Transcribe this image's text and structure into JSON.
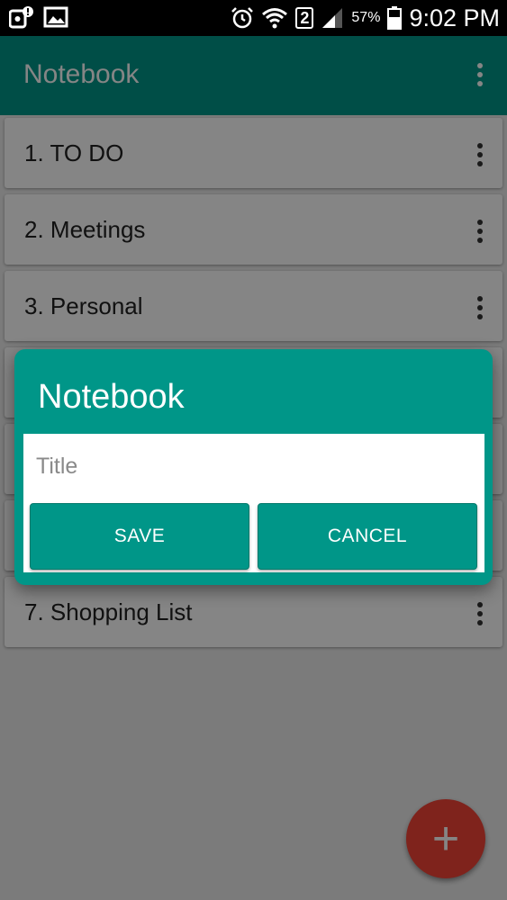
{
  "status_bar": {
    "time": "9:02 PM",
    "battery_percent": "57%",
    "sim_badge": "2",
    "icons": [
      "notification-alert-icon",
      "image-icon",
      "alarm-icon",
      "wifi-icon",
      "signal-icon",
      "battery-icon"
    ]
  },
  "app_bar": {
    "title": "Notebook",
    "menu_icon": "overflow-menu-icon"
  },
  "notebooks": [
    {
      "label": "1. TO DO"
    },
    {
      "label": "2. Meetings"
    },
    {
      "label": "3. Personal"
    },
    {
      "label": ""
    },
    {
      "label": ""
    },
    {
      "label": ""
    },
    {
      "label": "7. Shopping List"
    }
  ],
  "dialog": {
    "title": "Notebook",
    "input_placeholder": "Title",
    "input_value": "",
    "save_label": "SAVE",
    "cancel_label": "CANCEL"
  },
  "fab": {
    "icon": "plus-icon",
    "label": "+"
  },
  "colors": {
    "primary": "#009688",
    "accent": "#f44336"
  }
}
